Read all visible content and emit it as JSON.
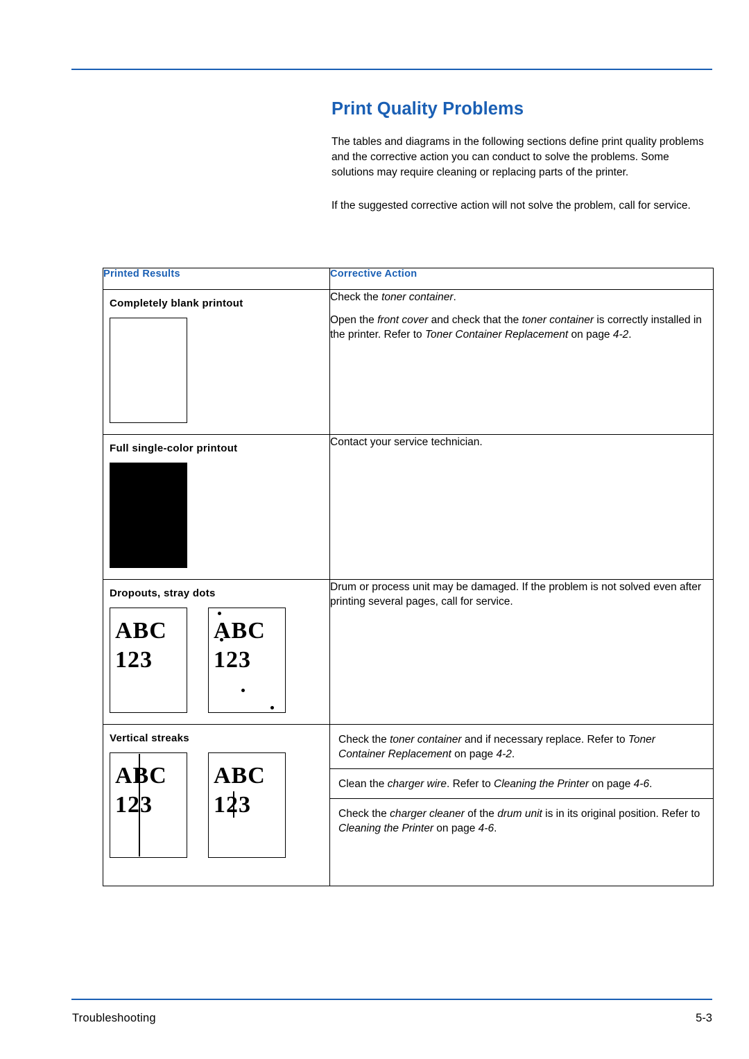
{
  "document": {
    "title": "Print Quality Problems",
    "intro": [
      "The tables and diagrams in the following sections define print quality problems and the corrective action you can conduct to solve the problems. Some solutions may require cleaning or replacing parts of the printer.",
      "If the suggested corrective action will not solve the problem, call for service."
    ],
    "footer": {
      "left": "Troubleshooting",
      "right": "5-3"
    }
  },
  "table": {
    "headers": {
      "printed_results": "Printed Results",
      "corrective_action": "Corrective Action"
    },
    "rows": [
      {
        "label": "Completely blank printout",
        "sample": "blank-page",
        "actions": [
          "Check the toner container.",
          "Open the front cover and check that the toner container is correctly installed in the printer. Refer to Toner Container Replacement on page 4-2."
        ]
      },
      {
        "label": "Full single-color printout",
        "sample": "solid-black-page",
        "actions": [
          "Contact your service technician."
        ]
      },
      {
        "label": "Dropouts, stray dots",
        "sample": "abc-dropouts",
        "actions": [
          "Drum or process unit may be damaged. If the problem is not solved even after printing several pages, call for service."
        ]
      },
      {
        "label": "Vertical streaks",
        "sample": "abc-streaks",
        "actions": [
          "Check the toner container and if necessary replace. Refer to Toner Container Replacement on page 4-2.",
          "Clean the charger wire. Refer to Cleaning the Printer on page 4-6.",
          "Check the charger cleaner of the drum unit is in its original position. Refer to Cleaning the Printer on page 4-6."
        ]
      }
    ],
    "sample_text": {
      "line1": "ABC",
      "line2": "123"
    }
  },
  "colors": {
    "accent": "#1a5fb4",
    "text": "#000000",
    "page_background": "#ffffff"
  }
}
